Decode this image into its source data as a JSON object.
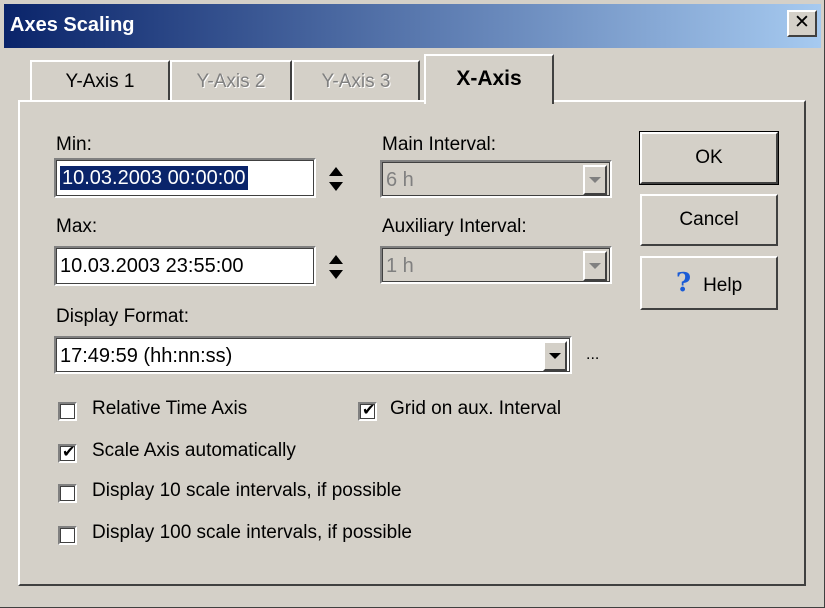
{
  "window": {
    "title": "Axes Scaling",
    "close_icon": "close-icon",
    "close_glyph": "✕"
  },
  "tabs": [
    {
      "label": "Y-Axis 1",
      "state": "enabled"
    },
    {
      "label": "Y-Axis 2",
      "state": "disabled"
    },
    {
      "label": "Y-Axis 3",
      "state": "disabled"
    },
    {
      "label": "X-Axis",
      "state": "active"
    }
  ],
  "min": {
    "label": "Min:",
    "value": "10.03.2003 00:00:00"
  },
  "max": {
    "label": "Max:",
    "value": "10.03.2003 23:55:00"
  },
  "main_interval": {
    "label": "Main Interval:",
    "value": "6 h"
  },
  "aux_interval": {
    "label": "Auxiliary Interval:",
    "value": "1 h"
  },
  "display_format": {
    "label": "Display Format:",
    "value": "17:49:59 (hh:nn:ss)",
    "more": "..."
  },
  "checkboxes": {
    "relative_time": {
      "label": "Relative Time Axis",
      "checked": false
    },
    "grid_aux": {
      "label": "Grid on aux. Interval",
      "checked": true
    },
    "scale_auto": {
      "label": "Scale Axis automatically",
      "checked": true
    },
    "display10": {
      "label": "Display 10 scale intervals, if possible",
      "checked": false
    },
    "display100": {
      "label": "Display 100 scale intervals, if possible",
      "checked": false
    }
  },
  "buttons": {
    "ok": "OK",
    "cancel": "Cancel",
    "help": "Help",
    "help_icon": "question-icon",
    "help_glyph": "?"
  },
  "check_glyph": "✔"
}
